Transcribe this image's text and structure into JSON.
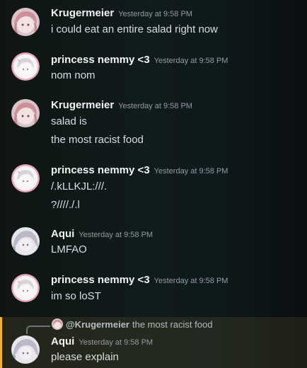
{
  "messages": [
    {
      "author": "Krugermeier",
      "timestamp": "Yesterday at 9:58 PM",
      "lines": [
        "i could eat an entire salad right now"
      ]
    },
    {
      "author": "princess nemmy <3",
      "timestamp": "Yesterday at 9:58 PM",
      "lines": [
        "nom nom"
      ]
    },
    {
      "author": "Krugermeier",
      "timestamp": "Yesterday at 9:58 PM",
      "lines": [
        "salad is",
        "the most racist food"
      ]
    },
    {
      "author": "princess nemmy <3",
      "timestamp": "Yesterday at 9:58 PM",
      "lines": [
        "/.kLLKJL:///.",
        "?////./.l"
      ]
    },
    {
      "author": "Aqui",
      "timestamp": "Yesterday at 9:58 PM",
      "lines": [
        "LMFAO"
      ]
    },
    {
      "author": "princess nemmy <3",
      "timestamp": "Yesterday at 9:58 PM",
      "lines": [
        "im so loST"
      ]
    },
    {
      "author": "Aqui",
      "timestamp": "Yesterday at 9:58 PM",
      "reply": {
        "mention": "@Krugermeier",
        "text": "the most racist food"
      },
      "lines": [
        "please explain"
      ]
    }
  ],
  "colors": {
    "highlight_bar": "#f0b232",
    "author": "#f2f3f5",
    "timestamp": "#949ba4",
    "text": "#dbdee1"
  }
}
